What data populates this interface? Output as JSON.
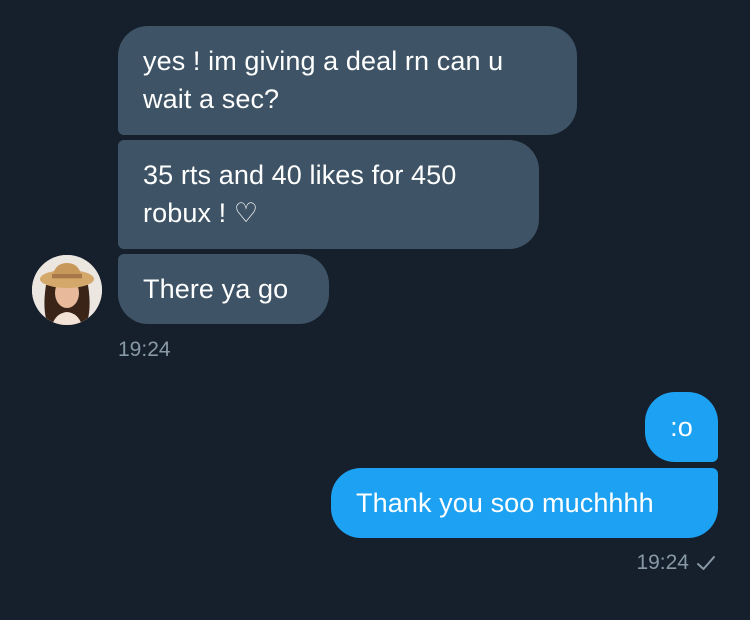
{
  "conversation": {
    "incoming": [
      {
        "text": "yes ! im giving a deal rn can u\nwait a sec?"
      },
      {
        "text": "35 rts and 40 likes for 450\nrobux ! ♡"
      },
      {
        "text": "There ya go"
      }
    ],
    "incoming_time": "19:24",
    "outgoing": [
      {
        "text": ":o"
      },
      {
        "text": "Thank you soo muchhhh"
      }
    ],
    "outgoing_time": "19:24"
  },
  "icons": {
    "read_receipt": "checkmark-icon",
    "avatar": "profile-photo"
  },
  "colors": {
    "background": "#16202c",
    "incoming_bubble": "#3e5466",
    "outgoing_bubble": "#1da1f2",
    "timestamp": "#8899a6"
  }
}
